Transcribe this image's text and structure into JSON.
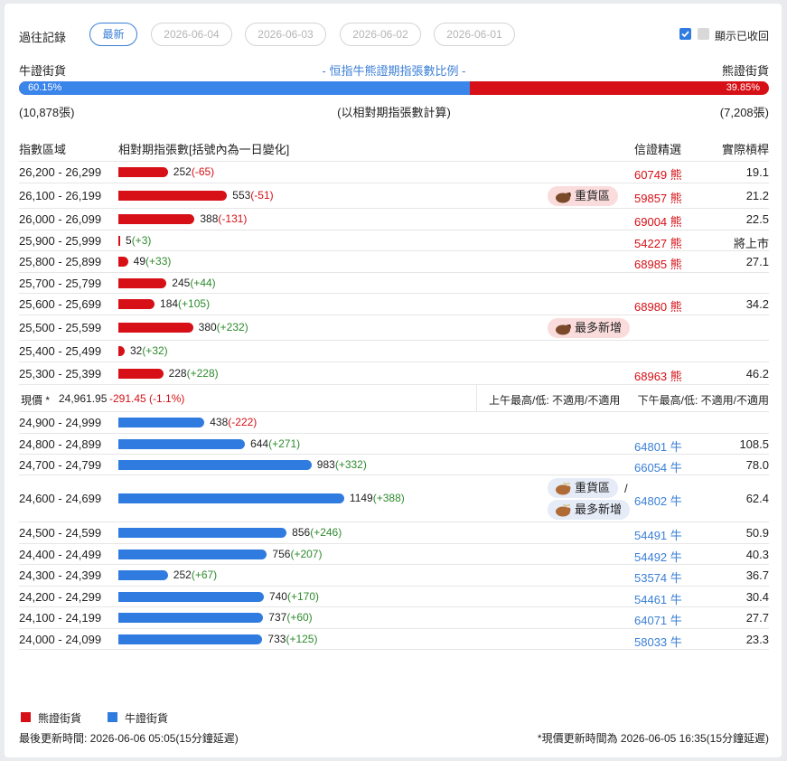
{
  "header": {
    "history_label": "過往記錄",
    "tabs": [
      "最新",
      "2026-06-04",
      "2026-06-03",
      "2026-06-02",
      "2026-06-01"
    ],
    "show_recalled_label": "顯示已收回"
  },
  "ratio": {
    "bull_label": "牛證街貨",
    "bear_label": "熊證街貨",
    "title": "- 恒指牛熊證期指張數比例 -",
    "bull_pct": "60.15%",
    "bear_pct": "39.85%",
    "bull_fraction": 0.6015,
    "bull_count": "(10,878張)",
    "bear_count": "(7,208張)",
    "note": "(以相對期指張數計算)"
  },
  "table": {
    "headers": {
      "range": "指數區域",
      "contracts": "相對期指張數[括號內為一日變化]",
      "pick": "信證精選",
      "strike": "實際槓桿"
    },
    "bear_rows": [
      {
        "range": "26,200 - 26,299",
        "value": 252,
        "num": "252",
        "chg": "(-65)",
        "code": "60749 熊",
        "strike": "19.1"
      },
      {
        "range": "26,100 - 26,199",
        "value": 553,
        "num": "553",
        "chg": "(-51)",
        "code": "59857 熊",
        "strike": "21.2",
        "badge": "重貨區"
      },
      {
        "range": "26,000 - 26,099",
        "value": 388,
        "num": "388",
        "chg": "(-131)",
        "code": "69004 熊",
        "strike": "22.5"
      },
      {
        "range": "25,900 - 25,999",
        "value": 5,
        "num": "5",
        "chg": "(+3)",
        "code": "54227 熊",
        "strike": "將上市"
      },
      {
        "range": "25,800 - 25,899",
        "value": 49,
        "num": "49",
        "chg": "(+33)",
        "code": "68985 熊",
        "strike": "27.1"
      },
      {
        "range": "25,700 - 25,799",
        "value": 245,
        "num": "245",
        "chg": "(+44)",
        "code": "",
        "strike": ""
      },
      {
        "range": "25,600 - 25,699",
        "value": 184,
        "num": "184",
        "chg": "(+105)",
        "code": "68980 熊",
        "strike": "34.2"
      },
      {
        "range": "25,500 - 25,599",
        "value": 380,
        "num": "380",
        "chg": "(+232)",
        "code": "",
        "strike": "",
        "badge": "最多新增"
      },
      {
        "range": "25,400 - 25,499",
        "value": 32,
        "num": "32",
        "chg": "(+32)",
        "code": "",
        "strike": ""
      },
      {
        "range": "25,300 - 25,399",
        "value": 228,
        "num": "228",
        "chg": "(+228)",
        "code": "68963 熊",
        "strike": "46.2"
      }
    ],
    "spot": {
      "label": "現價 *",
      "price": "24,961.95",
      "change": "-291.45 (-1.1%)",
      "am": "上午最高/低: 不適用/不適用",
      "pm": "下午最高/低: 不適用/不適用"
    },
    "bull_rows": [
      {
        "range": "24,900 - 24,999",
        "value": 438,
        "num": "438",
        "chg": "(-222)",
        "code": "",
        "strike": ""
      },
      {
        "range": "24,800 - 24,899",
        "value": 644,
        "num": "644",
        "chg": "(+271)",
        "code": "64801 牛",
        "strike": "108.5"
      },
      {
        "range": "24,700 - 24,799",
        "value": 983,
        "num": "983",
        "chg": "(+332)",
        "code": "66054 牛",
        "strike": "78.0"
      },
      {
        "range": "24,600 - 24,699",
        "value": 1149,
        "num": "1149",
        "chg": "(+388)",
        "code": "64802 牛",
        "strike": "62.4",
        "badges": [
          "重貨區",
          "最多新增"
        ],
        "sep": "/"
      },
      {
        "range": "24,500 - 24,599",
        "value": 856,
        "num": "856",
        "chg": "(+246)",
        "code": "54491 牛",
        "strike": "50.9"
      },
      {
        "range": "24,400 - 24,499",
        "value": 756,
        "num": "756",
        "chg": "(+207)",
        "code": "54492 牛",
        "strike": "40.3"
      },
      {
        "range": "24,300 - 24,399",
        "value": 252,
        "num": "252",
        "chg": "(+67)",
        "code": "53574 牛",
        "strike": "36.7"
      },
      {
        "range": "24,200 - 24,299",
        "value": 740,
        "num": "740",
        "chg": "(+170)",
        "code": "54461 牛",
        "strike": "30.4"
      },
      {
        "range": "24,100 - 24,199",
        "value": 737,
        "num": "737",
        "chg": "(+60)",
        "code": "64071 牛",
        "strike": "27.7"
      },
      {
        "range": "24,000 - 24,099",
        "value": 733,
        "num": "733",
        "chg": "(+125)",
        "code": "58033 牛",
        "strike": "23.3"
      }
    ]
  },
  "legend": {
    "bear": "熊證街貨",
    "bull": "牛證街貨",
    "bear_color": "#d61016",
    "bull_color": "#2f7be0"
  },
  "footer": {
    "last_update": "最後更新時間: 2026-06-06 05:05(15分鐘延遲)",
    "spot_update": "*現價更新時間為 2026-06-05 16:35(15分鐘延遲)"
  }
}
